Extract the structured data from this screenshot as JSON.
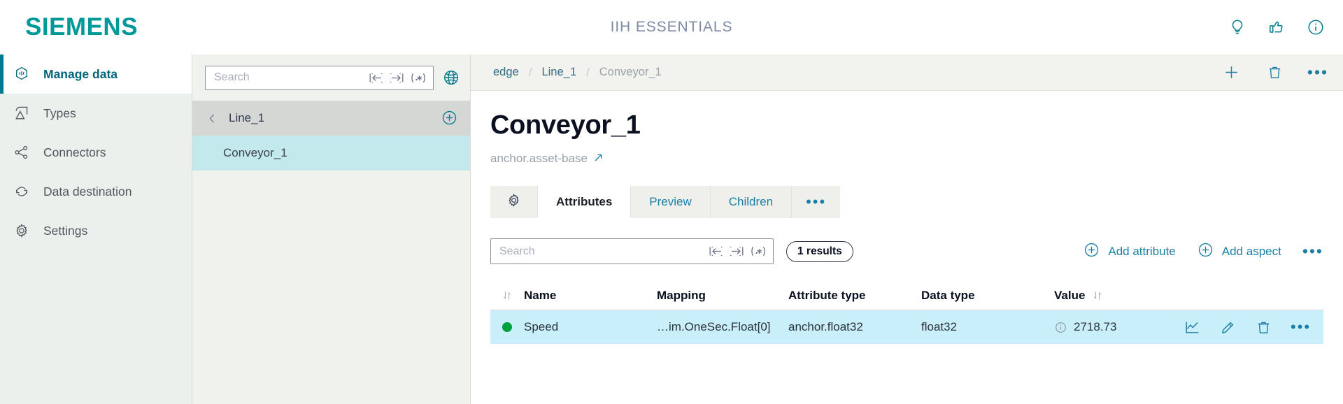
{
  "header": {
    "brand": "SIEMENS",
    "app_title": "IIH ESSENTIALS",
    "icons": [
      {
        "name": "lightbulb-icon",
        "label": "Tips"
      },
      {
        "name": "feedback-icon",
        "label": "Feedback"
      },
      {
        "name": "info-icon",
        "label": "Information"
      }
    ],
    "brand_color": "#009999",
    "accent_color": "#1d7fa3"
  },
  "sidebar": {
    "items": [
      {
        "label": "Manage data",
        "icon": "data-hexagon-icon",
        "active": true
      },
      {
        "label": "Types",
        "icon": "types-icon",
        "active": false
      },
      {
        "label": "Connectors",
        "icon": "connectors-icon",
        "active": false
      },
      {
        "label": "Data destination",
        "icon": "refresh-arrows-icon",
        "active": false
      },
      {
        "label": "Settings",
        "icon": "gear-icon",
        "active": false
      }
    ]
  },
  "tree_panel": {
    "search": {
      "value": "",
      "placeholder": "Search"
    },
    "search_icons": [
      "match-start-icon",
      "match-end-icon",
      "regex-icon"
    ],
    "globe_icon": "globe-icon",
    "parent": {
      "label": "Line_1",
      "back_icon": "chevron-left-icon",
      "add_icon": "plus-circle-icon"
    },
    "children": [
      {
        "label": "Conveyor_1",
        "selected": true
      }
    ]
  },
  "breadcrumb": {
    "items": [
      {
        "label": "edge",
        "current": false
      },
      {
        "label": "Line_1",
        "current": false
      },
      {
        "label": "Conveyor_1",
        "current": true
      }
    ],
    "separator": "/",
    "actions": [
      {
        "name": "add-icon",
        "label": "Add"
      },
      {
        "name": "delete-icon",
        "label": "Delete"
      },
      {
        "name": "more-icon",
        "label": "More",
        "glyph": "•••"
      }
    ]
  },
  "page": {
    "title": "Conveyor_1",
    "subtitle": "anchor.asset-base",
    "subtitle_link_icon": "external-link-icon"
  },
  "tabs": [
    {
      "label": "",
      "icon": "gear-icon",
      "active": false,
      "type": "icon"
    },
    {
      "label": "Attributes",
      "active": true,
      "type": "text"
    },
    {
      "label": "Preview",
      "active": false,
      "type": "text"
    },
    {
      "label": "Children",
      "active": false,
      "type": "text"
    },
    {
      "label": "•••",
      "active": false,
      "type": "dots"
    }
  ],
  "toolbar": {
    "search": {
      "value": "",
      "placeholder": "Search"
    },
    "search_icons": [
      "match-start-icon",
      "match-end-icon",
      "regex-icon"
    ],
    "results_badge": "1 results",
    "add_attribute_label": "Add attribute",
    "add_aspect_label": "Add aspect",
    "more_glyph": "•••"
  },
  "table": {
    "columns": [
      {
        "key": "status",
        "label": "",
        "sort_icon": "sort-refresh-icon"
      },
      {
        "key": "name",
        "label": "Name"
      },
      {
        "key": "mapping",
        "label": "Mapping"
      },
      {
        "key": "attribute_type",
        "label": "Attribute type"
      },
      {
        "key": "data_type",
        "label": "Data type"
      },
      {
        "key": "value",
        "label": "Value",
        "sort_icon": "sort-refresh-icon"
      }
    ],
    "rows": [
      {
        "status": "online",
        "status_color": "#00a03c",
        "name": "Speed",
        "mapping": "…im.OneSec.Float[0]",
        "attribute_type": "anchor.float32",
        "data_type": "float32",
        "value": "2718.73",
        "value_info_icon": "info-circle-icon",
        "selected": true,
        "actions": [
          {
            "name": "chart-icon",
            "label": "Chart"
          },
          {
            "name": "edit-icon",
            "label": "Edit"
          },
          {
            "name": "delete-icon",
            "label": "Delete"
          },
          {
            "name": "more-icon",
            "label": "More",
            "glyph": "•••"
          }
        ]
      }
    ]
  }
}
